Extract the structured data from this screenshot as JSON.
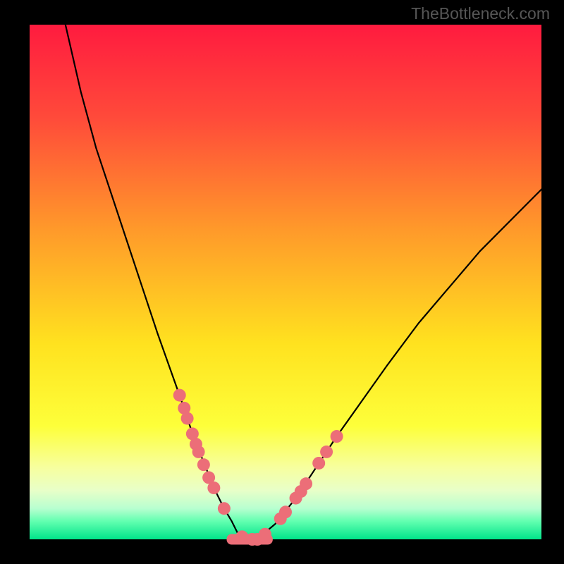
{
  "watermark": "TheBottleneck.com",
  "gradient": {
    "stops": [
      {
        "pos": 0,
        "color": "#ff1b3f"
      },
      {
        "pos": 0.18,
        "color": "#ff4a3a"
      },
      {
        "pos": 0.4,
        "color": "#ff9a2a"
      },
      {
        "pos": 0.62,
        "color": "#ffe21f"
      },
      {
        "pos": 0.78,
        "color": "#fdff3a"
      },
      {
        "pos": 0.86,
        "color": "#f7ff9e"
      },
      {
        "pos": 0.905,
        "color": "#e8ffc8"
      },
      {
        "pos": 0.94,
        "color": "#b8ffd0"
      },
      {
        "pos": 0.965,
        "color": "#62ffb0"
      },
      {
        "pos": 1.0,
        "color": "#00e48a"
      }
    ]
  },
  "chart_data": {
    "type": "line",
    "title": "",
    "xlabel": "",
    "ylabel": "",
    "xlim": [
      0,
      100
    ],
    "ylim": [
      0,
      100
    ],
    "series": [
      {
        "name": "bottleneck-curve",
        "x": [
          7,
          10,
          13,
          16,
          19,
          22,
          25,
          27.5,
          30,
          32,
          34,
          36,
          38,
          39.5,
          41,
          43,
          45,
          48,
          52,
          56,
          60,
          65,
          70,
          76,
          82,
          88,
          94,
          100
        ],
        "y": [
          100,
          87,
          76,
          67,
          58,
          49,
          40,
          33,
          26,
          20,
          15,
          10,
          6,
          3.5,
          0.5,
          0,
          0.5,
          3,
          8,
          14,
          20,
          27,
          34,
          42,
          49,
          56,
          62,
          68
        ]
      }
    ],
    "markers": {
      "name": "highlight-points",
      "color": "#ec6e78",
      "radius_px": 9,
      "x": [
        29.3,
        30.2,
        30.8,
        31.8,
        32.5,
        33.0,
        34.0,
        35.0,
        36.0,
        38.0,
        41.5,
        43.5,
        44.5,
        46.0,
        49.0,
        50.0,
        52.0,
        53.0,
        54.0,
        56.5,
        58.0,
        60.0
      ],
      "y": [
        28.0,
        25.5,
        23.5,
        20.5,
        18.5,
        17.0,
        14.5,
        12.0,
        10.0,
        6.0,
        0.5,
        0.0,
        0.0,
        1.0,
        4.0,
        5.3,
        8.0,
        9.3,
        10.8,
        14.8,
        17.0,
        20.0
      ]
    },
    "bottom_band": {
      "name": "marker-track",
      "color": "#ec6e78",
      "y": 0,
      "x_start": 38.5,
      "x_end": 47.5,
      "thickness_px": 15
    }
  }
}
